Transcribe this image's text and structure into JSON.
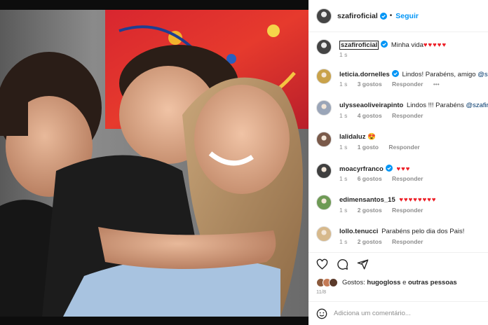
{
  "post": {
    "username": "szafiroficial",
    "separator": "•",
    "follow_label": "Seguir"
  },
  "caption": {
    "username": "szafiroficial",
    "text": "Minha vida",
    "hearts": "♥♥♥♥♥",
    "time": "1 s"
  },
  "comments": [
    {
      "username": "leticia.dornelles",
      "verified": true,
      "text": "Lindos! Parabéns, amigo ",
      "mention": "@szafiroficial",
      "hearts": "",
      "time": "1 s",
      "likes": "3 gostos",
      "reply": "Responder",
      "more": "•••",
      "avatar_color": "#c9a24a"
    },
    {
      "username": "ulysseaoliveirapinto",
      "verified": false,
      "text": "Lindos !!! Parabéns ",
      "mention": "@szafiroficial",
      "hearts": "",
      "time": "1 s",
      "likes": "4 gostos",
      "reply": "Responder",
      "more": "",
      "avatar_color": "#9aa5b8"
    },
    {
      "username": "lalidaluz",
      "verified": false,
      "text": "",
      "mention": "",
      "hearts": "😍",
      "time": "1 s",
      "likes": "1 gosto",
      "reply": "Responder",
      "more": "",
      "avatar_color": "#7a5a4a"
    },
    {
      "username": "moacyrfranco",
      "verified": true,
      "text": "",
      "mention": "",
      "hearts": "♥♥♥",
      "time": "1 s",
      "likes": "6 gostos",
      "reply": "Responder",
      "more": "",
      "avatar_color": "#3f3f3f"
    },
    {
      "username": "edimensantos_15",
      "verified": false,
      "text": "",
      "mention": "",
      "hearts": "♥♥♥♥♥♥♥♥",
      "time": "1 s",
      "likes": "2 gostos",
      "reply": "Responder",
      "more": "",
      "avatar_color": "#6e9a55"
    },
    {
      "username": "lollo.tenucci",
      "verified": false,
      "text": "Parabéns pelo dia dos Pais!",
      "mention": "",
      "hearts": "",
      "time": "1 s",
      "likes": "2 gostos",
      "reply": "Responder",
      "more": "",
      "avatar_color": "#d7b98c"
    }
  ],
  "likes": {
    "prefix": "Gostos:",
    "user": "hugogloss",
    "connector": "e",
    "others": "outras pessoas"
  },
  "date": "11/8",
  "add_comment": {
    "placeholder": "Adiciona um comentário..."
  },
  "colors": {
    "accent_blue": "#0095f6",
    "heart_red": "#ed1c24",
    "mention_blue": "#00376b",
    "muted_gray": "#8e8e8e"
  },
  "icons": [
    "heart-icon",
    "comment-icon",
    "share-icon",
    "emoji-icon",
    "verified-badge-icon",
    "more-options-icon"
  ]
}
